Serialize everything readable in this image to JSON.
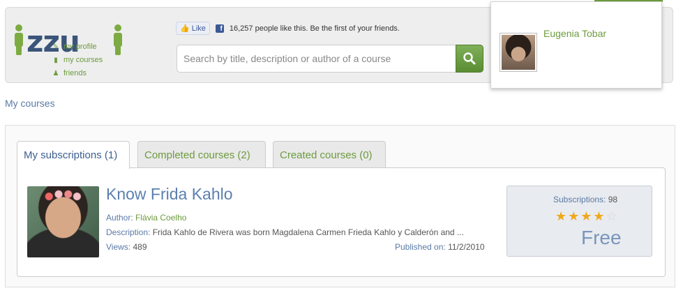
{
  "logo": {
    "text": "izzui",
    "colors": {
      "dark": "#3b5479",
      "green": "#7cab41"
    }
  },
  "facebook": {
    "like_label": "Like",
    "fb_glyph": "f",
    "like_text": "16,257 people like this. Be the first of your friends."
  },
  "search": {
    "placeholder": "Search by title, description or author of a course",
    "icon": "search-icon"
  },
  "profile": {
    "name": "Eugenia Tobar",
    "links": [
      {
        "label": "my profile",
        "icon": "pencil-icon"
      },
      {
        "label": "my courses",
        "icon": "book-icon"
      },
      {
        "label": "friends",
        "icon": "people-icon"
      }
    ]
  },
  "breadcrumb": "My courses",
  "tabs": [
    {
      "label": "My subscriptions (1)",
      "active": true
    },
    {
      "label": "Completed courses (2)",
      "active": false
    },
    {
      "label": "Created courses (0)",
      "active": false
    }
  ],
  "course": {
    "title": "Know Frida Kahlo",
    "author_label": "Author:",
    "author": "Flávia Coelho",
    "description_label": "Description:",
    "description": "Frida Kahlo de Rivera was born Magdalena Carmen Frieda Kahlo y Calderón and ...",
    "views_label": "Views:",
    "views": "489",
    "published_label": "Published on:",
    "published": "11/2/2010",
    "subscriptions_label": "Subscriptions:",
    "subscriptions": "98",
    "rating": 4,
    "rating_max": 5,
    "price": "Free"
  },
  "theme": {
    "accent_green": "#6d9b3e",
    "accent_blue": "#5b7fb0",
    "star": "#f0a81a"
  }
}
